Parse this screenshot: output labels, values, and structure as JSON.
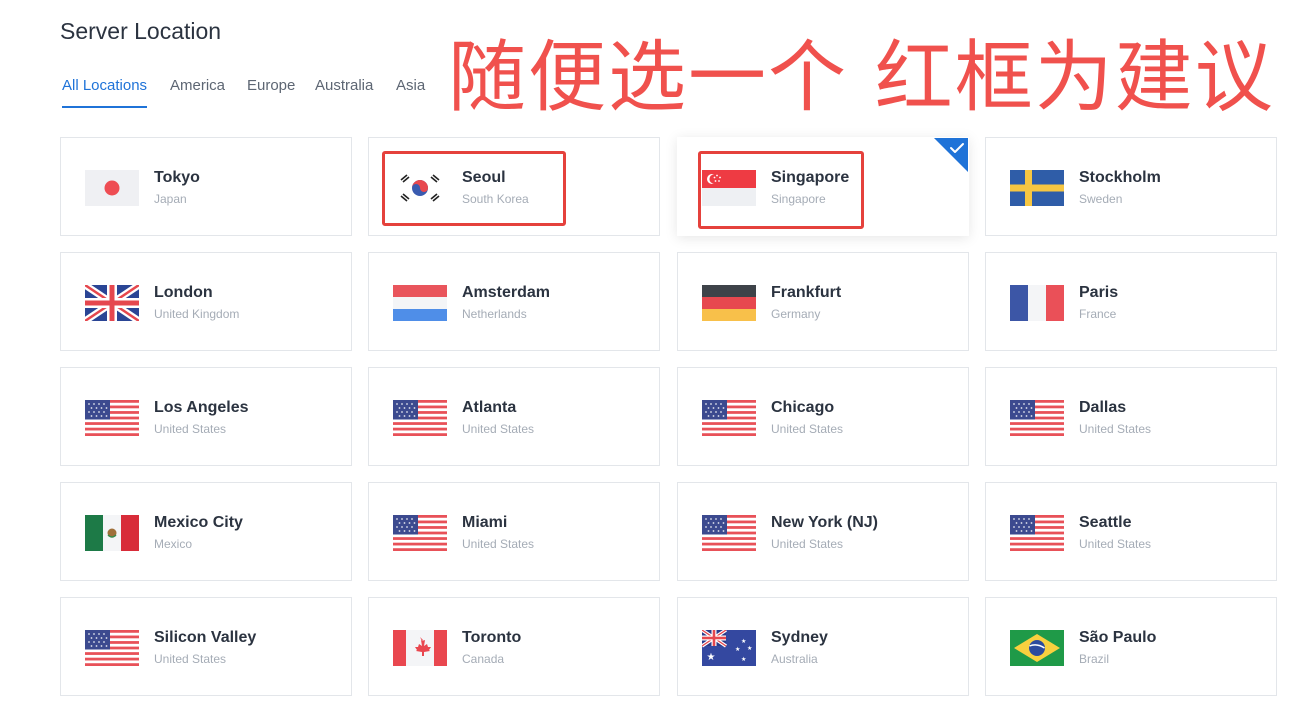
{
  "page_title": "Server Location",
  "tabs": [
    {
      "label": "All Locations",
      "active": true
    },
    {
      "label": "America"
    },
    {
      "label": "Europe"
    },
    {
      "label": "Australia"
    },
    {
      "label": "Asia"
    }
  ],
  "annotation": "随便选一个 红框为建议",
  "locations": [
    {
      "city": "Tokyo",
      "country": "Japan",
      "flag": "japan-flag-icon"
    },
    {
      "city": "Seoul",
      "country": "South Korea",
      "flag": "south-korea-flag-icon"
    },
    {
      "city": "Singapore",
      "country": "Singapore",
      "flag": "singapore-flag-icon",
      "selected": true
    },
    {
      "city": "Stockholm",
      "country": "Sweden",
      "flag": "sweden-flag-icon"
    },
    {
      "city": "London",
      "country": "United Kingdom",
      "flag": "uk-flag-icon"
    },
    {
      "city": "Amsterdam",
      "country": "Netherlands",
      "flag": "netherlands-flag-icon"
    },
    {
      "city": "Frankfurt",
      "country": "Germany",
      "flag": "germany-flag-icon"
    },
    {
      "city": "Paris",
      "country": "France",
      "flag": "france-flag-icon"
    },
    {
      "city": "Los Angeles",
      "country": "United States",
      "flag": "usa-flag-icon"
    },
    {
      "city": "Atlanta",
      "country": "United States",
      "flag": "usa-flag-icon"
    },
    {
      "city": "Chicago",
      "country": "United States",
      "flag": "usa-flag-icon"
    },
    {
      "city": "Dallas",
      "country": "United States",
      "flag": "usa-flag-icon"
    },
    {
      "city": "Mexico City",
      "country": "Mexico",
      "flag": "mexico-flag-icon"
    },
    {
      "city": "Miami",
      "country": "United States",
      "flag": "usa-flag-icon"
    },
    {
      "city": "New York (NJ)",
      "country": "United States",
      "flag": "usa-flag-icon"
    },
    {
      "city": "Seattle",
      "country": "United States",
      "flag": "usa-flag-icon"
    },
    {
      "city": "Silicon Valley",
      "country": "United States",
      "flag": "usa-flag-icon"
    },
    {
      "city": "Toronto",
      "country": "Canada",
      "flag": "canada-flag-icon"
    },
    {
      "city": "Sydney",
      "country": "Australia",
      "flag": "australia-flag-icon"
    },
    {
      "city": "São Paulo",
      "country": "Brazil",
      "flag": "brazil-flag-icon"
    }
  ],
  "colors": {
    "accent": "#1f73d8",
    "annotation_red": "#f0514d",
    "highlight_box": "#e5413c"
  }
}
